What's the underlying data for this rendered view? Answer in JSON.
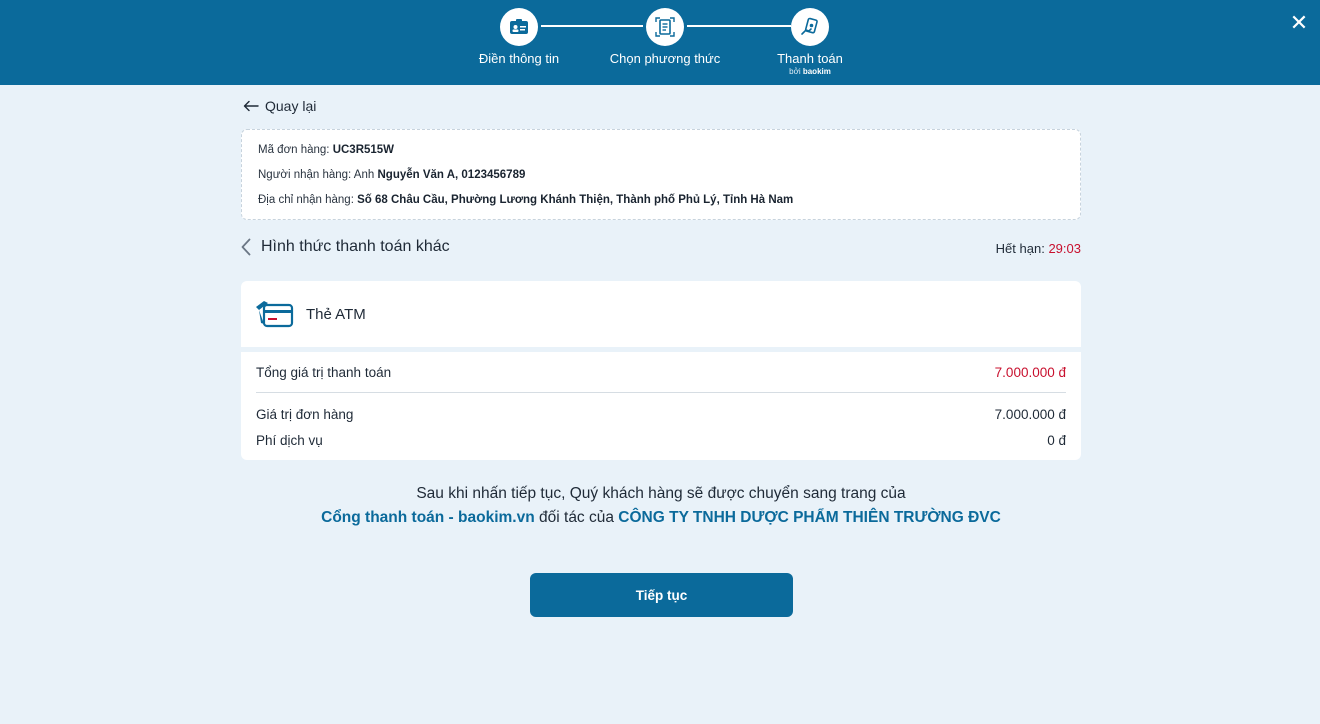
{
  "header": {
    "steps": [
      {
        "label": "Điền thông tin",
        "icon": "id-card-icon"
      },
      {
        "label": "Chọn phương thức",
        "icon": "document-select-icon"
      },
      {
        "label": "Thanh toán",
        "icon": "payment-hand-icon",
        "sub_prefix": "bởi",
        "sub_brand": "baokim"
      }
    ],
    "close_label": "✕"
  },
  "back_label": "Quay lại",
  "order": {
    "code_label": "Mã đơn hàng:",
    "code_value": "UC3R515W",
    "recipient_label": "Người nhận hàng: Anh",
    "recipient_value": "Nguyễn Văn A, 0123456789",
    "address_label": "Địa chỉ nhận hàng:",
    "address_value": "Số 68 Châu Cầu, Phường Lương Khánh Thiện, Thành phố Phủ Lý, Tỉnh Hà Nam"
  },
  "method_title": "Hình thức thanh toán khác",
  "expire": {
    "label": "Hết hạn:",
    "time": "29:03"
  },
  "atm": {
    "title": "Thẻ ATM"
  },
  "summary": {
    "total_label": "Tổng giá trị thanh toán",
    "total_value": "7.000.000 đ",
    "order_label": "Giá trị đơn hàng",
    "order_value": "7.000.000 đ",
    "fee_label": "Phí dịch vụ",
    "fee_value": "0 đ"
  },
  "notice": {
    "line1": "Sau khi nhấn tiếp tục, Quý khách hàng sẽ được chuyển sang trang của",
    "gateway": "Cổng thanh toán - baokim.vn",
    "partner_text": "đối tác của",
    "company": "CÔNG TY TNHH DƯỢC PHẨM THIÊN TRƯỜNG ĐVC"
  },
  "continue_label": "Tiếp tục",
  "colors": {
    "primary": "#0b6a9b",
    "accent_red": "#c8102e",
    "background": "#e9f2f9"
  }
}
